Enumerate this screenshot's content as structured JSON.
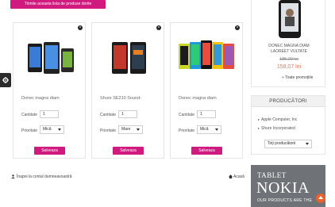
{
  "share_button": "Trimite aceasta lista de produse dorite",
  "products": [
    {
      "name": "Donec magna diam",
      "qty_label": "Cantitate",
      "qty": "1",
      "priority_label": "Prioritate",
      "priority": "Mică",
      "action": "Salveaza"
    },
    {
      "name": "Shure SE210 Sound-",
      "qty_label": "Cantitate",
      "qty": "1",
      "priority_label": "Prioritate",
      "priority": "Mare",
      "action": "Salveaza"
    },
    {
      "name": "Donec magna diam",
      "qty_label": "Cantitate",
      "qty": "1",
      "priority_label": "Prioritate",
      "priority": "Mică",
      "action": "Salveaza"
    }
  ],
  "footer": {
    "back_link": "Înapoi la contul dumneavoastră",
    "home_link": "Acasă"
  },
  "sidebar": {
    "promo": {
      "name_line1": "DONEC MAGNA DIAM",
      "name_line2": "LAOREET VULTATE",
      "old_price": "185,29 lei",
      "new_price": "158,07 lei",
      "all_link": "» Toate promoțiile"
    },
    "producers": {
      "title": "PRODUCĂTORI",
      "items": [
        "Apple Computer, Inc",
        "Shure Incorporated"
      ],
      "select": "Toți producătorii"
    },
    "banner": {
      "line1": "TABLET",
      "line2": "NOKIA",
      "line3": "OUR PRODUCTS ARE THE"
    }
  },
  "icons": {
    "close": "close-icon",
    "settings": "gear-icon",
    "user": "user-icon",
    "home": "home-icon",
    "scroll_top": "arrow-up-icon"
  },
  "colors": {
    "accent": "#d01a7f",
    "price": "#e08060",
    "banner": "#6f7276",
    "scroll_top": "#e8632d"
  }
}
